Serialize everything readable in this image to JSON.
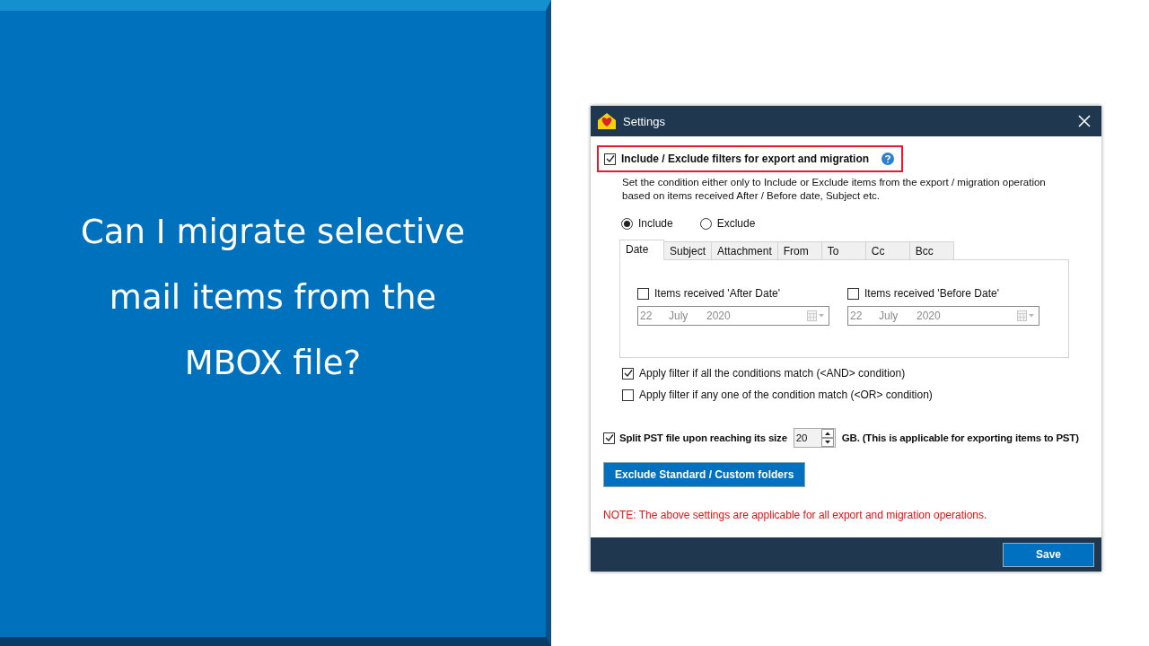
{
  "slide": {
    "heading": "Can I migrate selective mail items from the MBOX file?"
  },
  "dialog": {
    "title": "Settings",
    "filter_toggle": {
      "label": "Include / Exclude filters for export and migration",
      "checked": true,
      "highlighted": true
    },
    "description": "Set the condition either only to Include or Exclude items from the export / migration operation based on items received After / Before date, Subject etc.",
    "mode_options": [
      {
        "label": "Include",
        "selected": true
      },
      {
        "label": "Exclude",
        "selected": false
      }
    ],
    "tabs": [
      {
        "label": "Date",
        "selected": true
      },
      {
        "label": "Subject",
        "selected": false
      },
      {
        "label": "Attachment",
        "selected": false
      },
      {
        "label": "From",
        "selected": false
      },
      {
        "label": "To",
        "selected": false
      },
      {
        "label": "Cc",
        "selected": false
      },
      {
        "label": "Bcc",
        "selected": false
      }
    ],
    "date_filters": [
      {
        "label": "Items received 'After Date'",
        "checked": false,
        "day": "22",
        "month": "July",
        "year": "2020"
      },
      {
        "label": "Items received 'Before Date'",
        "checked": false,
        "day": "22",
        "month": "July",
        "year": "2020"
      }
    ],
    "match_options": [
      {
        "label": "Apply filter if all the conditions match (<AND> condition)",
        "checked": true
      },
      {
        "label": "Apply filter if any one of the condition match (<OR> condition)",
        "checked": false
      }
    ],
    "split": {
      "label": "Split PST file upon reaching its size",
      "checked": true,
      "value": "20",
      "suffix": "GB. (This is applicable for exporting items to PST)"
    },
    "exclude_button": "Exclude Standard / Custom folders",
    "note": "NOTE: The above settings are applicable for all export and migration operations.",
    "save_button": "Save"
  }
}
